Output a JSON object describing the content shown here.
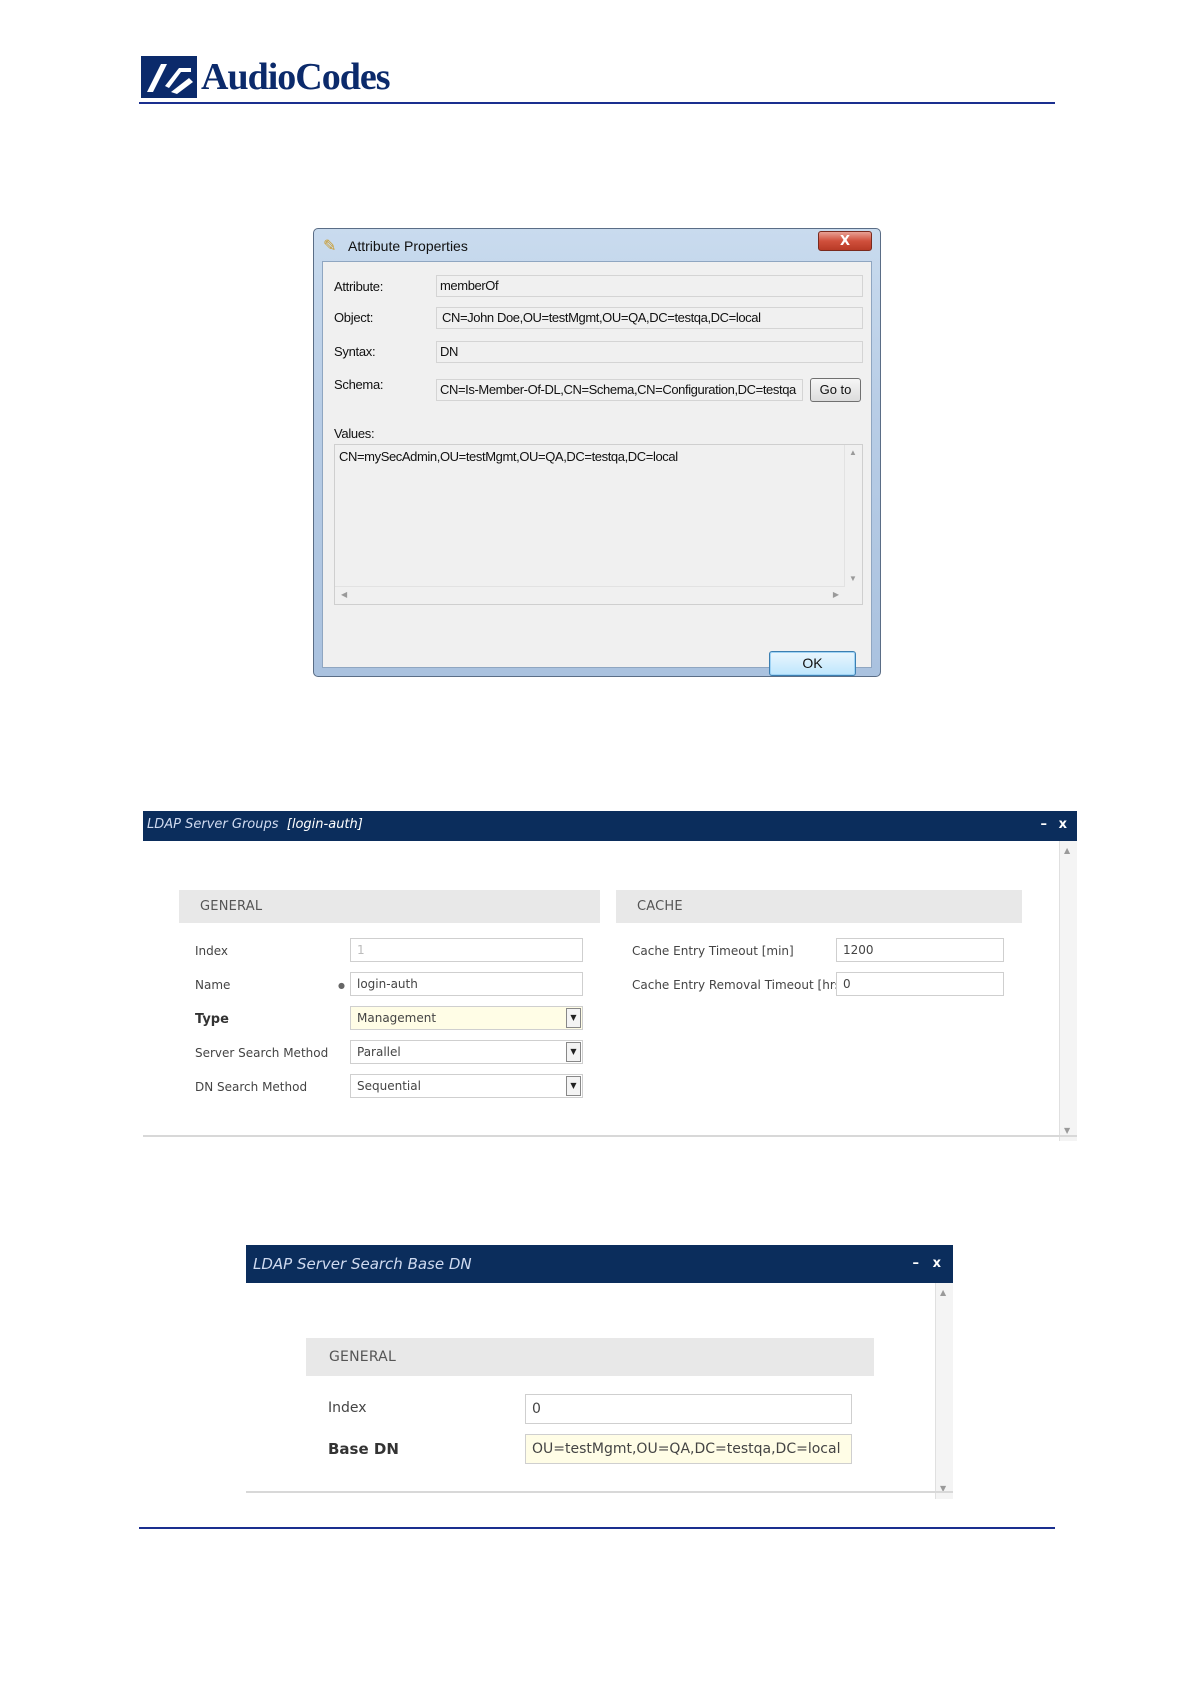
{
  "header": {
    "logo_text": "AudioCodes"
  },
  "attribute_dialog": {
    "title": "Attribute Properties",
    "close_glyph": "X",
    "fields": {
      "attribute": {
        "label": "Attribute:",
        "value": "memberOf"
      },
      "object": {
        "label": "Object:",
        "value": "CN=John Doe,OU=testMgmt,OU=QA,DC=testqa,DC=local"
      },
      "syntax": {
        "label": "Syntax:",
        "value": "DN"
      },
      "schema": {
        "label": "Schema:",
        "value": "CN=Is-Member-Of-DL,CN=Schema,CN=Configuration,DC=testqa"
      }
    },
    "goto_label": "Go to",
    "values_label": "Values:",
    "values_text": "CN=mySecAdmin,OU=testMgmt,OU=QA,DC=testqa,DC=local",
    "ok_label": "OK"
  },
  "ldap_server_groups": {
    "title": "LDAP Server Groups",
    "title_suffix": "[login-auth]",
    "minimize_glyph": "–",
    "close_glyph": "x",
    "general": {
      "heading": "GENERAL",
      "index": {
        "label": "Index",
        "value": "1"
      },
      "name": {
        "label": "Name",
        "value": "login-auth"
      },
      "type": {
        "label": "Type",
        "value": "Management"
      },
      "server_search_method": {
        "label": "Server Search Method",
        "value": "Parallel"
      },
      "dn_search_method": {
        "label": "DN Search Method",
        "value": "Sequential"
      }
    },
    "cache": {
      "heading": "CACHE",
      "entry_timeout": {
        "label": "Cache Entry Timeout [min]",
        "value": "1200"
      },
      "removal_timeout": {
        "label": "Cache Entry Removal Timeout [hrs]",
        "value": "0"
      }
    }
  },
  "ldap_search_base_dn": {
    "title": "LDAP Server Search Base DN",
    "minimize_glyph": "–",
    "close_glyph": "x",
    "general": {
      "heading": "GENERAL",
      "index": {
        "label": "Index",
        "value": "0"
      },
      "base_dn": {
        "label": "Base DN",
        "value": "OU=testMgmt,OU=QA,DC=testqa,DC=local"
      }
    }
  }
}
